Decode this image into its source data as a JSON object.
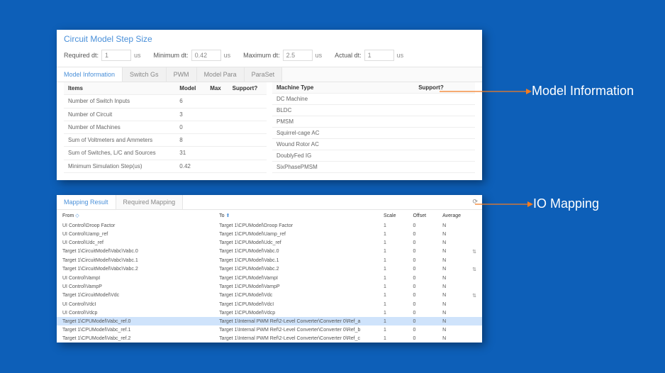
{
  "panel1": {
    "title": "Circuit Model Step Size",
    "dt": {
      "required_label": "Required dt:",
      "required_value": "1",
      "minimum_label": "Minimum dt:",
      "minimum_value": "0.42",
      "maximum_label": "Maximum dt:",
      "maximum_value": "2.5",
      "actual_label": "Actual dt:",
      "actual_value": "1",
      "unit": "us"
    },
    "tabs": [
      "Model Information",
      "Switch Gs",
      "PWM",
      "Model Para",
      "ParaSet"
    ],
    "tbl1": {
      "headers": [
        "Items",
        "Model",
        "Max",
        "Support?"
      ],
      "rows": [
        [
          "Number of Switch Inputs",
          "6",
          "",
          ""
        ],
        [
          "Number of Circuit",
          "3",
          "",
          ""
        ],
        [
          "Number of Machines",
          "0",
          "",
          ""
        ],
        [
          "Sum of Voltmeters and Ammeters",
          "8",
          "",
          ""
        ],
        [
          "Sum of Switches, L/C and Sources",
          "31",
          "",
          ""
        ],
        [
          "Minimum Simulation Step(us)",
          "0.42",
          "",
          ""
        ]
      ]
    },
    "tbl2": {
      "headers": [
        "Machine Type",
        "Support?"
      ],
      "rows": [
        [
          "DC Machine",
          ""
        ],
        [
          "BLDC",
          ""
        ],
        [
          "PMSM",
          ""
        ],
        [
          "Squirrel-cage AC",
          ""
        ],
        [
          "Wound Rotor AC",
          ""
        ],
        [
          "DoublyFed IG",
          ""
        ],
        [
          "SixPhasePMSM",
          ""
        ]
      ]
    }
  },
  "panel2": {
    "tabs": [
      "Mapping Result",
      "Required Mapping"
    ],
    "headers": [
      "From",
      "To",
      "Scale",
      "Offset",
      "Average"
    ],
    "rows": [
      {
        "from": "UI Control\\Droop Factor",
        "to": "Target 1\\CPUModel\\Droop Factor",
        "scale": "1",
        "offset": "0",
        "avg": "N",
        "icon": "",
        "hl": false
      },
      {
        "from": "UI Control\\Uamp_ref",
        "to": "Target 1\\CPUModel\\Uamp_ref",
        "scale": "1",
        "offset": "0",
        "avg": "N",
        "icon": "",
        "hl": false
      },
      {
        "from": "UI Control\\Udc_ref",
        "to": "Target 1\\CPUModel\\Udc_ref",
        "scale": "1",
        "offset": "0",
        "avg": "N",
        "icon": "",
        "hl": false
      },
      {
        "from": "Target 1\\CircuitModel\\Vabc\\Vabc.0",
        "to": "Target 1\\CPUModel\\Vabc.0",
        "scale": "1",
        "offset": "0",
        "avg": "N",
        "icon": "⇅",
        "hl": false
      },
      {
        "from": "Target 1\\CircuitModel\\Vabc\\Vabc.1",
        "to": "Target 1\\CPUModel\\Vabc.1",
        "scale": "1",
        "offset": "0",
        "avg": "N",
        "icon": "",
        "hl": false
      },
      {
        "from": "Target 1\\CircuitModel\\Vabc\\Vabc.2",
        "to": "Target 1\\CPUModel\\Vabc.2",
        "scale": "1",
        "offset": "0",
        "avg": "N",
        "icon": "⇅",
        "hl": false
      },
      {
        "from": "UI Control\\VampI",
        "to": "Target 1\\CPUModel\\VampI",
        "scale": "1",
        "offset": "0",
        "avg": "N",
        "icon": "",
        "hl": false
      },
      {
        "from": "UI Control\\VampP",
        "to": "Target 1\\CPUModel\\VampP",
        "scale": "1",
        "offset": "0",
        "avg": "N",
        "icon": "",
        "hl": false
      },
      {
        "from": "Target 1\\CircuitModel\\Vdc",
        "to": "Target 1\\CPUModel\\Vdc",
        "scale": "1",
        "offset": "0",
        "avg": "N",
        "icon": "⇅",
        "hl": false
      },
      {
        "from": "UI Control\\VdcI",
        "to": "Target 1\\CPUModel\\VdcI",
        "scale": "1",
        "offset": "0",
        "avg": "N",
        "icon": "",
        "hl": false
      },
      {
        "from": "UI Control\\Vdcp",
        "to": "Target 1\\CPUModel\\Vdcp",
        "scale": "1",
        "offset": "0",
        "avg": "N",
        "icon": "",
        "hl": false
      },
      {
        "from": "Target 1\\CPUModel\\Vabc_ref.0",
        "to": "Target 1\\Internal PWM Ref\\2-Level Converter\\Converter 0\\Ref_a",
        "scale": "1",
        "offset": "0",
        "avg": "N",
        "icon": "",
        "hl": true
      },
      {
        "from": "Target 1\\CPUModel\\Vabc_ref.1",
        "to": "Target 1\\Internal PWM Ref\\2-Level Converter\\Converter 0\\Ref_b",
        "scale": "1",
        "offset": "0",
        "avg": "N",
        "icon": "",
        "hl": false
      },
      {
        "from": "Target 1\\CPUModel\\Vabc_ref.2",
        "to": "Target 1\\Internal PWM Ref\\2-Level Converter\\Converter 0\\Ref_c",
        "scale": "1",
        "offset": "0",
        "avg": "N",
        "icon": "",
        "hl": false
      }
    ]
  },
  "callouts": {
    "model_info": "Model Information",
    "io_mapping": "IO Mapping"
  }
}
